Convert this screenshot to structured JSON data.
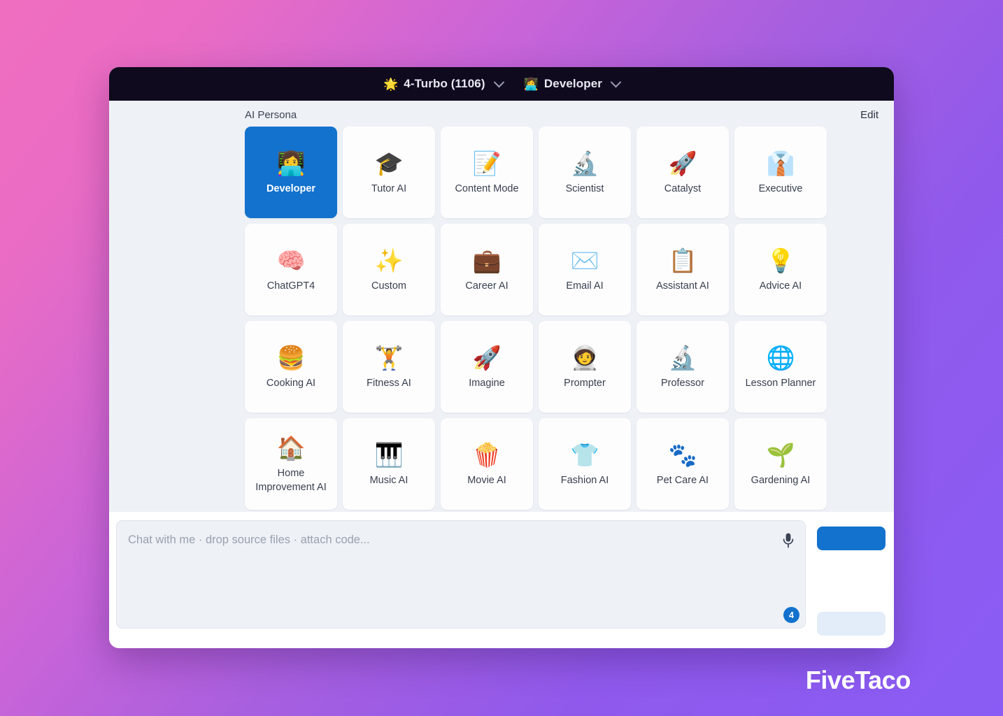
{
  "colors": {
    "accent": "#1272ce",
    "titlebar": "#100a1e",
    "panel_bg": "#eef1f6",
    "card_bg": "#fdfdfe",
    "bg_gradient_start": "#f06ec0",
    "bg_gradient_end": "#8a5cf5"
  },
  "titlebar": {
    "model": {
      "emoji": "🌟",
      "label": "4-Turbo (1106)",
      "chevron": "chevron-down-icon"
    },
    "persona": {
      "emoji": "👩‍💻",
      "label": "Developer",
      "chevron": "chevron-down-icon"
    }
  },
  "panel": {
    "title": "AI Persona",
    "edit_label": "Edit"
  },
  "personas": [
    {
      "label": "Developer",
      "emoji": "👩‍💻",
      "icon": "person-laptop-icon",
      "selected": true
    },
    {
      "label": "Tutor AI",
      "emoji": "🎓",
      "icon": "graduation-cap-icon",
      "selected": false
    },
    {
      "label": "Content Mode",
      "emoji": "📝",
      "icon": "memo-pencil-icon",
      "selected": false
    },
    {
      "label": "Scientist",
      "emoji": "🔬",
      "icon": "microscope-icon",
      "selected": false
    },
    {
      "label": "Catalyst",
      "emoji": "🚀",
      "icon": "rocket-icon",
      "selected": false
    },
    {
      "label": "Executive",
      "emoji": "👔",
      "icon": "necktie-icon",
      "selected": false
    },
    {
      "label": "ChatGPT4",
      "emoji": "🧠",
      "icon": "brain-icon",
      "selected": false
    },
    {
      "label": "Custom",
      "emoji": "✨",
      "icon": "sparkles-icon",
      "selected": false
    },
    {
      "label": "Career AI",
      "emoji": "💼",
      "icon": "briefcase-icon",
      "selected": false
    },
    {
      "label": "Email AI",
      "emoji": "✉️",
      "icon": "envelope-icon",
      "selected": false
    },
    {
      "label": "Assistant AI",
      "emoji": "📋",
      "icon": "clipboard-icon",
      "selected": false
    },
    {
      "label": "Advice AI",
      "emoji": "💡",
      "icon": "lightbulb-icon",
      "selected": false
    },
    {
      "label": "Cooking AI",
      "emoji": "🍔",
      "icon": "hamburger-icon",
      "selected": false
    },
    {
      "label": "Fitness AI",
      "emoji": "🏋️",
      "icon": "weightlifter-icon",
      "selected": false
    },
    {
      "label": "Imagine",
      "emoji": "🚀",
      "icon": "rocket-icon",
      "selected": false
    },
    {
      "label": "Prompter",
      "emoji": "🧑‍🚀",
      "icon": "astronaut-icon",
      "selected": false
    },
    {
      "label": "Professor",
      "emoji": "🔬",
      "icon": "microscope-icon",
      "selected": false
    },
    {
      "label": "Lesson Planner",
      "emoji": "🌐",
      "icon": "globe-meridians-icon",
      "selected": false
    },
    {
      "label": "Home Improvement AI",
      "emoji": "🏠",
      "icon": "house-icon",
      "selected": false
    },
    {
      "label": "Music AI",
      "emoji": "🎹",
      "icon": "piano-icon",
      "selected": false
    },
    {
      "label": "Movie AI",
      "emoji": "🍿",
      "icon": "popcorn-icon",
      "selected": false
    },
    {
      "label": "Fashion AI",
      "emoji": "👕",
      "icon": "tshirt-icon",
      "selected": false
    },
    {
      "label": "Pet Care AI",
      "emoji": "🐾",
      "icon": "paw-prints-icon",
      "selected": false
    },
    {
      "label": "Gardening AI",
      "emoji": "🌱",
      "icon": "seedling-icon",
      "selected": false
    }
  ],
  "composer": {
    "placeholder": "Chat with me · drop source files · attach code...",
    "value": "",
    "mic_icon": "microphone-icon",
    "badge_count": "4"
  },
  "watermark": "FiveTaco"
}
